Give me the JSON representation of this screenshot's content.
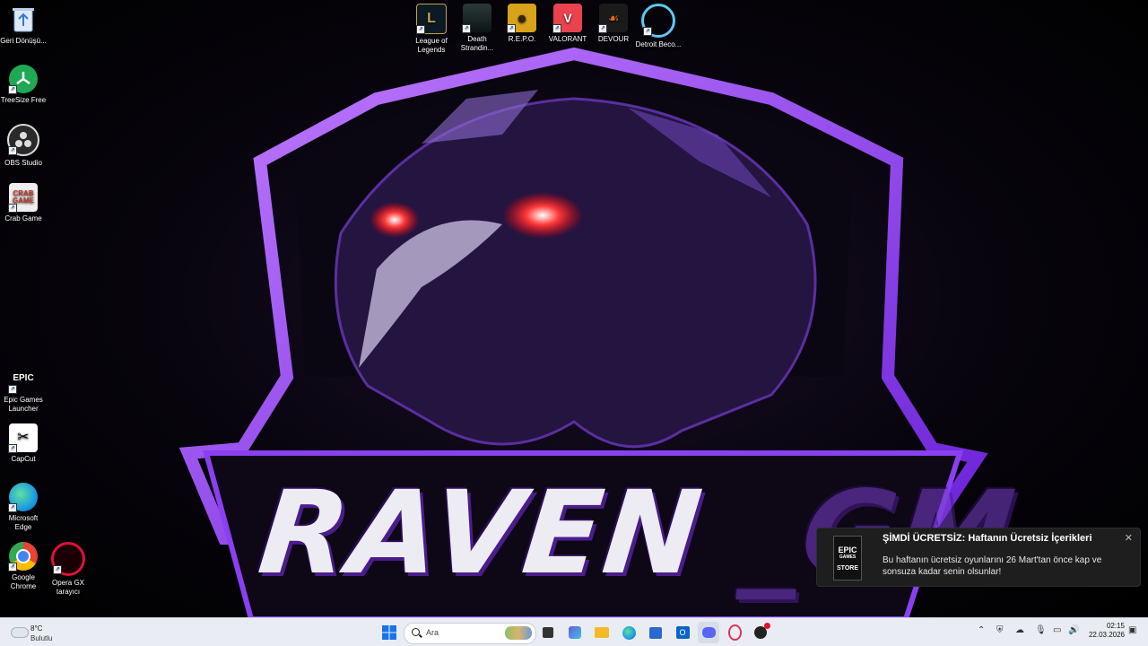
{
  "desktop": {
    "left_icons": [
      {
        "label": "Geri Dönüşü...",
        "icon": "recycle-bin-icon"
      },
      {
        "label": "TreeSize Free",
        "icon": "treesize-icon"
      },
      {
        "label": "OBS Studio",
        "icon": "obs-icon"
      },
      {
        "label": "Crab Game",
        "icon": "crab-game-icon"
      },
      {
        "label": "Epic Games Launcher",
        "icon": "epic-games-icon",
        "glyph": "EPIC"
      },
      {
        "label": "CapCut",
        "icon": "capcut-icon"
      },
      {
        "label": "Microsoft Edge",
        "icon": "edge-icon"
      },
      {
        "label": "Google Chrome",
        "icon": "chrome-icon"
      },
      {
        "label": "Opera GX tarayıcı",
        "icon": "opera-gx-icon"
      }
    ],
    "top_icons": [
      {
        "label": "League of Legends",
        "icon": "league-of-legends-icon"
      },
      {
        "label": "Death Strandin...",
        "icon": "death-stranding-icon"
      },
      {
        "label": "R.E.P.O.",
        "icon": "repo-icon"
      },
      {
        "label": "VALORANT",
        "icon": "valorant-icon"
      },
      {
        "label": "DEVOUR",
        "icon": "devour-icon"
      },
      {
        "label": "Detroit Beco...",
        "icon": "detroit-icon"
      }
    ],
    "wallpaper": {
      "text_main": "RAVEN",
      "text_dim": "GM",
      "accent": "#8a3ff0"
    }
  },
  "notification": {
    "logo_top": "EPIC",
    "logo_mid": "GAMES",
    "logo_bottom": "STORE",
    "title": "ŞİMDİ ÜCRETSİZ: Haftanın Ücretsiz İçerikleri",
    "body": "Bu haftanın ücretsiz oyunlarını 26 Mart'tan önce kap ve sonsuza kadar senin olsunlar!",
    "close": "✕"
  },
  "taskbar": {
    "weather_temp": "8°C",
    "weather_condition": "Bulutlu",
    "search_placeholder": "Ara",
    "apps": [
      {
        "name": "start-button",
        "color": "#1a73e8"
      },
      {
        "name": "task-view-button",
        "color": "#333333"
      },
      {
        "name": "widgets-button",
        "color": "#6b5bd9"
      },
      {
        "name": "file-explorer-button",
        "color": "#f2b928"
      },
      {
        "name": "edge-button",
        "color": "#1b9de2"
      },
      {
        "name": "store-button",
        "color": "#2a6ad0"
      },
      {
        "name": "outlook-button",
        "color": "#0a64c8"
      },
      {
        "name": "discord-button",
        "color": "#5865f2"
      },
      {
        "name": "opera-button",
        "color": "#e0325a"
      },
      {
        "name": "steam-like-button",
        "color": "#222222"
      }
    ],
    "clock_time": "02:15",
    "clock_date": "22.03.2026"
  }
}
